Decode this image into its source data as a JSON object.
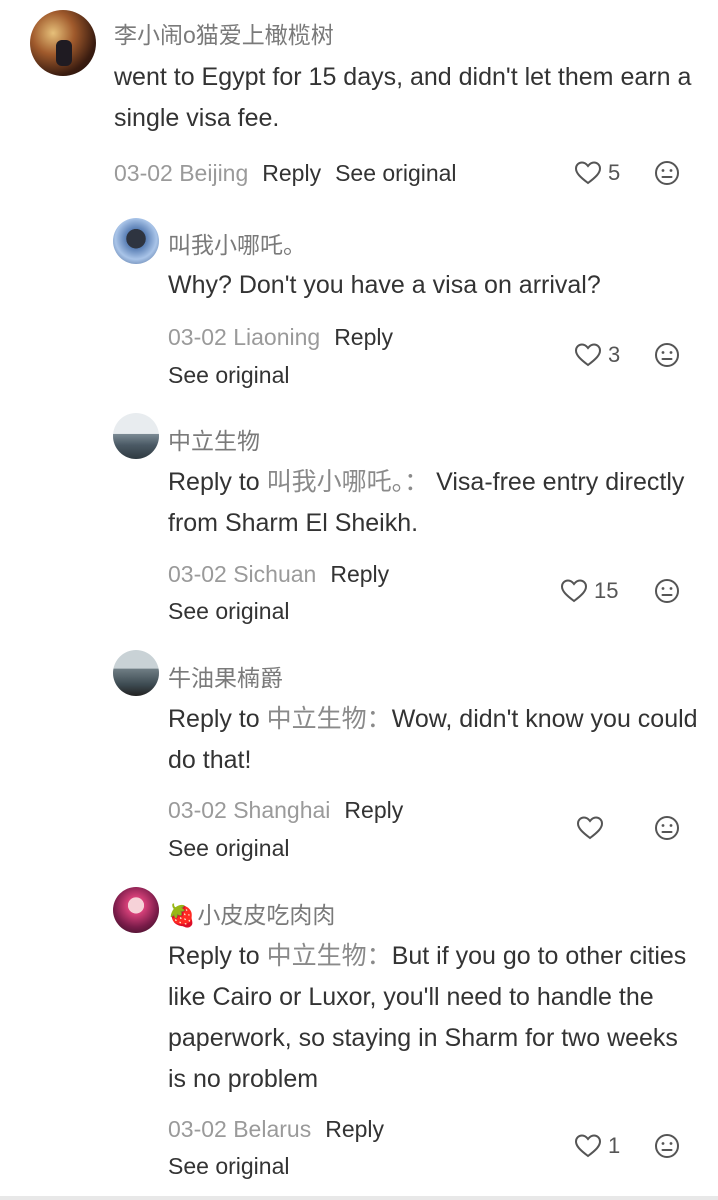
{
  "comment": {
    "user": "李小闹o猫爱上橄榄树",
    "text": " went to Egypt for 15 days, and didn't let them earn a single visa fee.",
    "date": "03-02 Beijing",
    "reply_label": "Reply",
    "see_original_label": "See original",
    "likes": "5"
  },
  "replies": [
    {
      "user": "叫我小哪吒。",
      "text": "Why? Don't you have a visa on arrival?",
      "date": "03-02 Liaoning",
      "reply_label": "Reply",
      "see_original_label": "See original",
      "likes": "3"
    },
    {
      "user": "中立生物",
      "reply_prefix": "Reply to",
      "reply_target": "叫我小哪吒。：",
      "text": "Visa-free entry directly from Sharm El Sheikh.",
      "date": "03-02 Sichuan",
      "reply_label": "Reply",
      "see_original_label": "See original",
      "likes": "15"
    },
    {
      "user": "牛油果楠爵",
      "reply_prefix": "Reply to",
      "reply_target": "中立生物：",
      "text": "Wow, didn't know you could do that!",
      "date": "03-02 Shanghai",
      "reply_label": "Reply",
      "see_original_label": "See original",
      "likes": ""
    },
    {
      "user": "小皮皮吃肉肉",
      "user_emoji": "🍓",
      "reply_prefix": "Reply to",
      "reply_target": "中立生物：",
      "text": "But if you go to other cities like Cairo or Luxor, you'll need to handle the paperwork, so staying in Sharm for two weeks is no problem",
      "date": "03-02 Belarus",
      "reply_label": "Reply",
      "see_original_label": "See original",
      "likes": "1"
    }
  ]
}
